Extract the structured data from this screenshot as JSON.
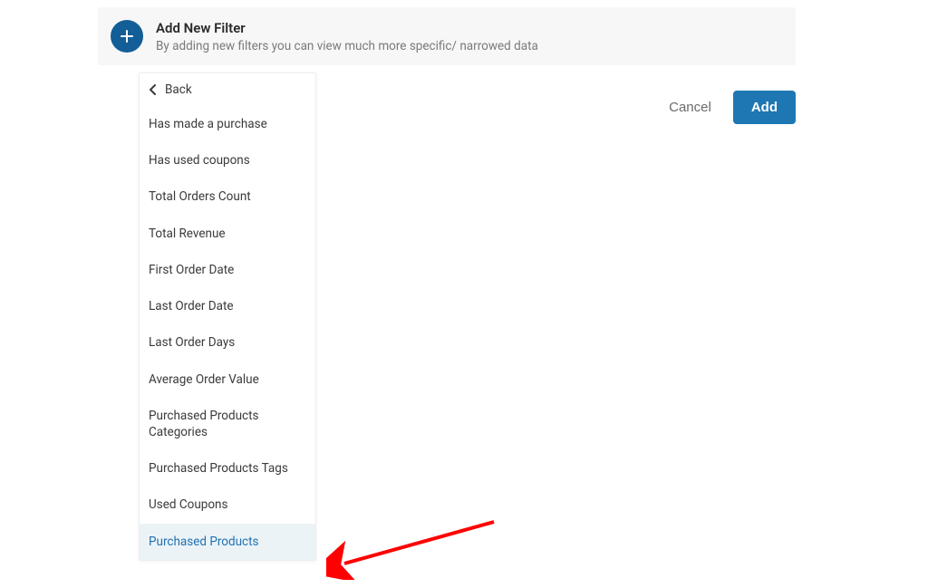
{
  "header": {
    "title": "Add New Filter",
    "subtitle": "By adding new filters you can view much more specific/ narrowed data"
  },
  "actions": {
    "cancel_label": "Cancel",
    "add_label": "Add"
  },
  "dropdown": {
    "back_label": "Back",
    "items": [
      "Has made a purchase",
      "Has used coupons",
      "Total Orders Count",
      "Total Revenue",
      "First Order Date",
      "Last Order Date",
      "Last Order Days",
      "Average Order Value",
      "Purchased Products Categories",
      "Purchased Products Tags",
      "Used Coupons",
      "Purchased Products"
    ],
    "selected_index": 11
  }
}
